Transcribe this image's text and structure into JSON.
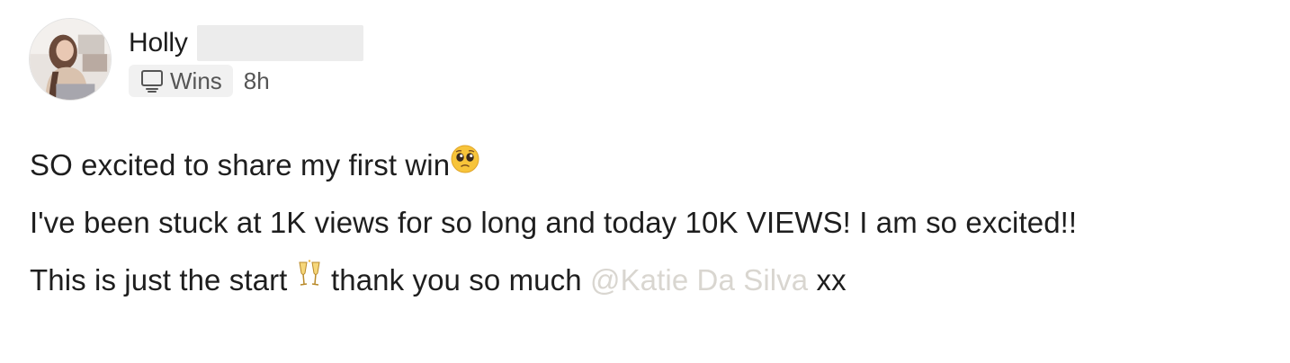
{
  "post": {
    "author": {
      "name": "Holly",
      "avatar_icon": "user-avatar-photo"
    },
    "category": {
      "icon": "monitor-icon",
      "label": "Wins"
    },
    "timestamp": "8h",
    "body": {
      "line1": {
        "text": "SO excited to share my first win",
        "emoji": "pleading-face-emoji"
      },
      "line2": {
        "text": "I've been stuck at 1K views for so long and today 10K VIEWS! I am so excited!!"
      },
      "line3": {
        "before": "This is just the start ",
        "emoji": "clinking-glasses-emoji",
        "middle": " thank you so much ",
        "mention": "@Katie Da Silva",
        "after": " xx"
      }
    },
    "colors": {
      "mention": "#d9d6d0",
      "chip_background": "#f1f1f1",
      "text": "#1e1e1e",
      "meta_text": "#555555"
    }
  }
}
